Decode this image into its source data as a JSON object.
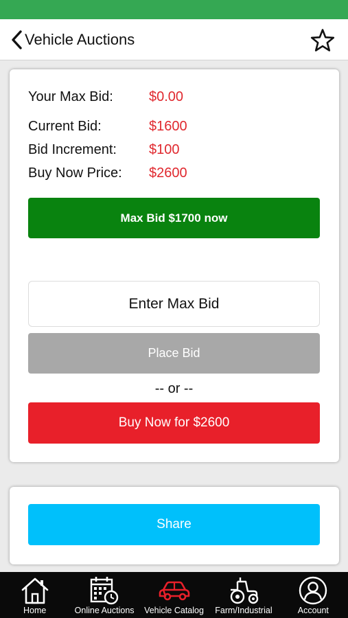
{
  "colors": {
    "status_bar": "#35a853",
    "accent_red": "#e0282e",
    "max_bid_green": "#09830f",
    "place_bid_gray": "#a8a8a8",
    "buy_now_red": "#e8202a",
    "share_blue": "#00c0fb",
    "tab_active": "#e8202a"
  },
  "header": {
    "back_icon": "chevron-left-icon",
    "title": "Vehicle Auctions",
    "favorite_icon": "star-outline-icon"
  },
  "bid_panel": {
    "rows": [
      {
        "label": "Your Max Bid:",
        "value": "$0.00"
      },
      {
        "label": "Current Bid:",
        "value": "$1600"
      },
      {
        "label": "Bid Increment:",
        "value": "$100"
      },
      {
        "label": "Buy Now Price:",
        "value": "$2600"
      }
    ],
    "max_bid_button": "Max Bid $1700 now",
    "max_bid_input_placeholder": "Enter Max Bid",
    "place_bid_button": "Place Bid",
    "or_separator": "-- or --",
    "buy_now_button": "Buy Now for $2600"
  },
  "share_panel": {
    "share_button": "Share"
  },
  "tab_bar": {
    "tabs": [
      {
        "label": "Home",
        "icon": "home-icon",
        "active": false
      },
      {
        "label": "Online Auctions",
        "icon": "calendar-clock-icon",
        "active": false
      },
      {
        "label": "Vehicle Catalog",
        "icon": "car-icon",
        "active": true
      },
      {
        "label": "Farm/Industrial",
        "icon": "tractor-icon",
        "active": false
      },
      {
        "label": "Account",
        "icon": "user-icon",
        "active": false
      }
    ]
  }
}
